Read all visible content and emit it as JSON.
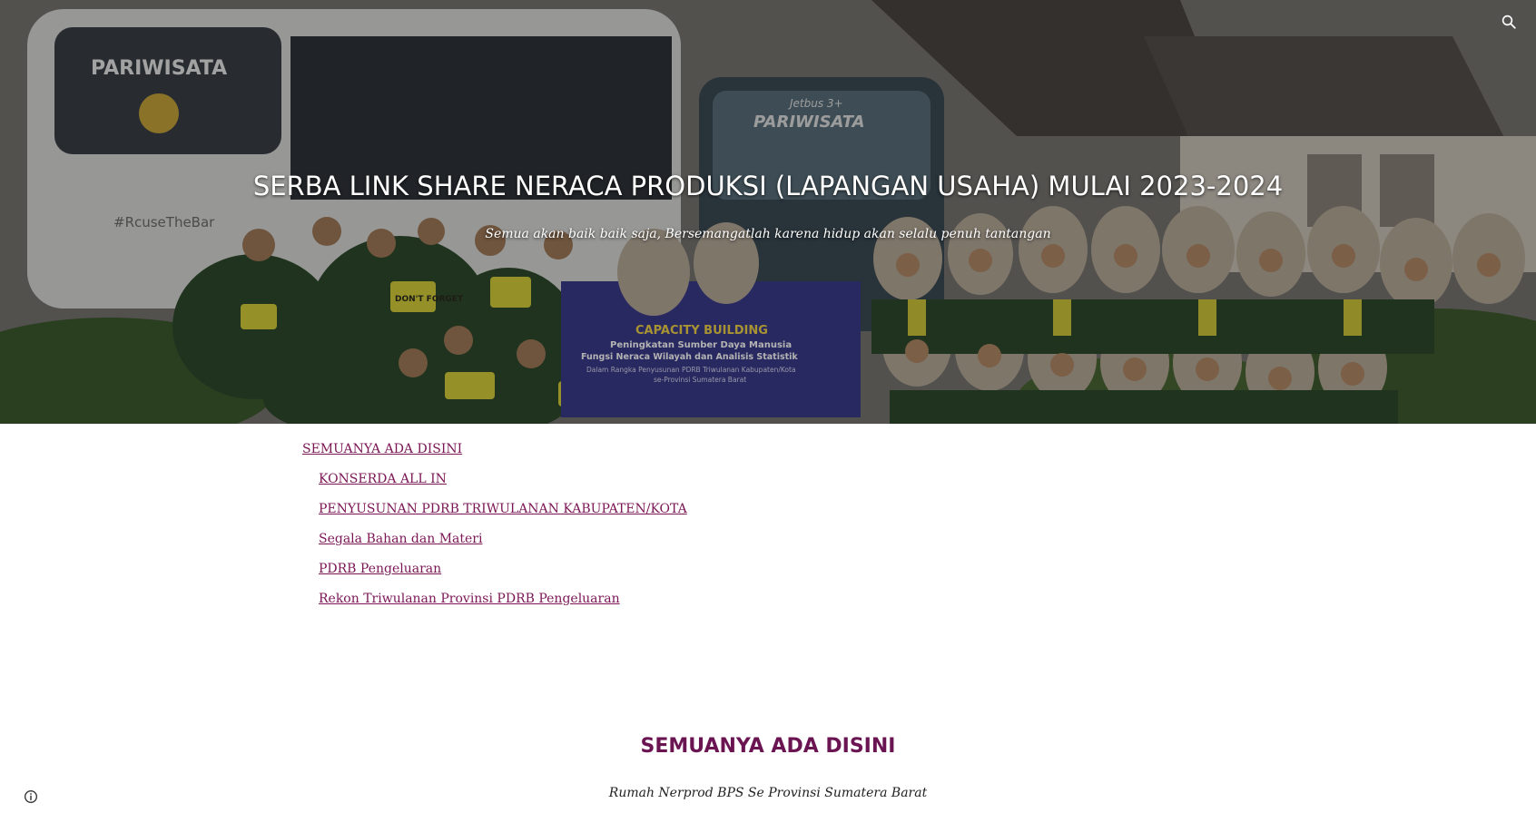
{
  "hero": {
    "title": "SERBA LINK SHARE NERACA PRODUKSI (LAPANGAN USAHA) MULAI 2023-2024",
    "subtitle": "Semua akan baik baik saja, Bersemangatlah karena hidup akan selalu penuh tantangan",
    "photo_texts": {
      "bus_left_brand": "PARIWISATA",
      "bus_right_brand": "PARIWISATA",
      "bus_right_model": "Jetbus 3+",
      "bus_left_slogan": "#RcuseTheBar",
      "banner_heading": "CAPACITY BUILDING",
      "banner_line1": "Peningkatan Sumber Daya Manusia",
      "banner_line2": "Fungsi Neraca Wilayah dan Analisis Statistik",
      "banner_line3": "Dalam Rangka Penyusunan PDRB Triwulanan Kabupaten/Kota",
      "banner_line4": "se-Provinsi Sumatera Barat",
      "shirt_text": "DON'T FORGET"
    },
    "search_icon": "search-icon"
  },
  "nav": {
    "top_label": "SEMUANYA ADA DISINI",
    "items": [
      {
        "label": "KONSERDA ALL IN"
      },
      {
        "label": "PENYUSUNAN PDRB TRIWULANAN KABUPATEN/KOTA"
      },
      {
        "label": "Segala Bahan dan Materi"
      },
      {
        "label": "PDRB Pengeluaran"
      },
      {
        "label": "Rekon Triwulanan Provinsi PDRB Pengeluaran"
      }
    ]
  },
  "section": {
    "heading": "SEMUANYA ADA DISINI",
    "text": "Rumah Nerprod BPS Se Provinsi Sumatera Barat"
  },
  "footer": {
    "info_icon": "info-icon"
  },
  "colors": {
    "link": "#7b1655",
    "heading": "#6b1452"
  }
}
